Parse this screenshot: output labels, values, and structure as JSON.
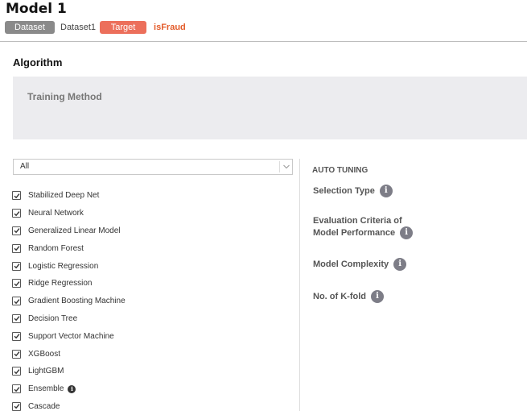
{
  "header": {
    "title": "Model 1",
    "dataset_badge": "Dataset",
    "dataset_name": "Dataset1",
    "target_badge": "Target",
    "target_name": "isFraud"
  },
  "algorithm": {
    "section_title": "Algorithm",
    "training_method_label": "Training Method"
  },
  "filter": {
    "selected": "All"
  },
  "models": [
    {
      "label": "Stabilized Deep Net",
      "checked": true
    },
    {
      "label": "Neural Network",
      "checked": true
    },
    {
      "label": "Generalized Linear Model",
      "checked": true
    },
    {
      "label": "Random Forest",
      "checked": true
    },
    {
      "label": "Logistic Regression",
      "checked": true
    },
    {
      "label": "Ridge Regression",
      "checked": true
    },
    {
      "label": "Gradient Boosting Machine",
      "checked": true
    },
    {
      "label": "Decision Tree",
      "checked": true
    },
    {
      "label": "Support Vector Machine",
      "checked": true
    },
    {
      "label": "XGBoost",
      "checked": true
    },
    {
      "label": "LightGBM",
      "checked": true
    },
    {
      "label": "Ensemble",
      "checked": true
    },
    {
      "label": "Cascade",
      "checked": true
    }
  ],
  "auto_tuning": {
    "title": "AUTO TUNING",
    "selection_type": "Selection Type",
    "eval_line1": "Evaluation Criteria of",
    "eval_line2": "Model Performance",
    "model_complexity": "Model Complexity",
    "kfold": "No. of K-fold"
  },
  "colors": {
    "dataset_badge": "#8a8a8a",
    "target_badge": "#ec6f5b",
    "target_name": "#e35b2a",
    "panel_bg": "#ececef"
  }
}
